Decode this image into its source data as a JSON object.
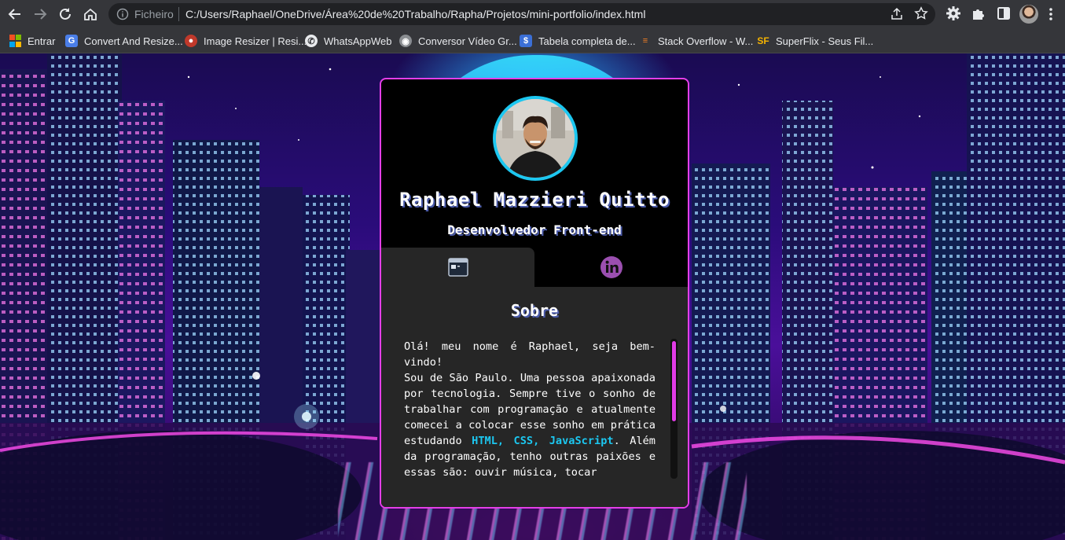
{
  "browser": {
    "scheme_label": "Ficheiro",
    "url": "C:/Users/Raphael/OneDrive/Área%20de%20Trabalho/Rapha/Projetos/mini-portfolio/index.html",
    "bookmarks": [
      {
        "label": "Entrar",
        "icon": "windows-icon"
      },
      {
        "label": "Convert And Resize...",
        "icon": "google-icon"
      },
      {
        "label": "Image Resizer | Resi...",
        "icon": "image-resizer-icon"
      },
      {
        "label": "WhatsAppWeb",
        "icon": "whatsapp-icon"
      },
      {
        "label": "Conversor Vídeo Gr...",
        "icon": "conversor-icon"
      },
      {
        "label": "Tabela completa de...",
        "icon": "tabela-icon"
      },
      {
        "label": "Stack Overflow - W...",
        "icon": "stackoverflow-icon"
      },
      {
        "label": "SuperFlix - Seus Fil...",
        "icon": "superflix-icon"
      }
    ]
  },
  "profile": {
    "name": "Raphael Mazzieri Quitto",
    "role": "Desenvolvedor Front-end"
  },
  "tabs": {
    "about_icon": "browser-window-icon",
    "linkedin_icon": "linkedin-icon",
    "linkedin_label": "in"
  },
  "about": {
    "title": "Sobre",
    "p1": "Olá! meu nome é Raphael, seja bem-vindo!",
    "p2_start": "Sou de São Paulo. Uma pessoa apaixonada por tecnologia. Sempre tive o sonho de trabalhar com programação e atualmente comecei a colocar esse sonho em prática estudando ",
    "highlight": "HTML, CSS, JavaScript",
    "p2_end": ". Além da programação, tenho outras paixões e essas são: ouvir música, tocar"
  },
  "colors": {
    "card_border": "#e43ee8",
    "accent_cyan": "#1cc7f0",
    "scroll_thumb": "#e13be6",
    "linkedin_purple": "#9b4fb0"
  }
}
